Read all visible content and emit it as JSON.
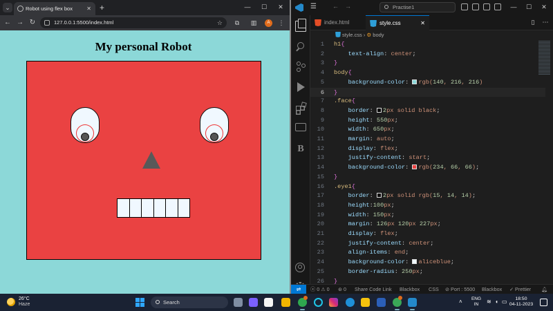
{
  "browser": {
    "tab_title": "Robot using flex box",
    "url": "127.0.0.1:5500/index.html",
    "avatar_letter": "A",
    "page_heading": "My personal Robot"
  },
  "vscode": {
    "search_text": "Practise1",
    "tabs": [
      {
        "label": "index.html",
        "active": false
      },
      {
        "label": "style.css",
        "active": true
      }
    ],
    "breadcrumb": {
      "file": "style.css",
      "symbol": "body"
    },
    "code_lines": [
      {
        "n": "1",
        "text": "h1{"
      },
      {
        "n": "2",
        "text": "    text-align: center;"
      },
      {
        "n": "3",
        "text": "}"
      },
      {
        "n": "4",
        "text": "body{"
      },
      {
        "n": "5",
        "text": "    background-color: rgb(140, 216, 216)"
      },
      {
        "n": "6",
        "text": "}"
      },
      {
        "n": "7",
        "text": ".face{"
      },
      {
        "n": "8",
        "text": "    border: 2px solid black;"
      },
      {
        "n": "9",
        "text": "    height: 550px;"
      },
      {
        "n": "10",
        "text": "    width: 650px;"
      },
      {
        "n": "11",
        "text": "    margin: auto;"
      },
      {
        "n": "12",
        "text": "    display: flex;"
      },
      {
        "n": "13",
        "text": "    justify-content: start;"
      },
      {
        "n": "14",
        "text": "    background-color: rgb(234, 66, 66);"
      },
      {
        "n": "15",
        "text": "}"
      },
      {
        "n": "16",
        "text": ".eye1{"
      },
      {
        "n": "17",
        "text": "    border: 2px solid rgb(15, 14, 14);"
      },
      {
        "n": "18",
        "text": "    height:100px;"
      },
      {
        "n": "19",
        "text": "    width: 150px;"
      },
      {
        "n": "20",
        "text": "    margin: 126px 120px 227px;"
      },
      {
        "n": "21",
        "text": "    display: flex;"
      },
      {
        "n": "22",
        "text": "    justify-content: center;"
      },
      {
        "n": "23",
        "text": "    align-items: end;"
      },
      {
        "n": "24",
        "text": "    background-color: aliceblue;"
      },
      {
        "n": "25",
        "text": "    border-radius: 250px;"
      },
      {
        "n": "26",
        "text": "}"
      }
    ],
    "active_line": "6",
    "status": {
      "errors": "0",
      "warnings": "0",
      "ports": "0",
      "share": "Share Code Link",
      "blackbox1": "Blackbox",
      "language": "CSS",
      "port": "Port : 5500",
      "blackbox2": "Blackbox",
      "prettier": "Prettier"
    }
  },
  "taskbar": {
    "temperature": "26°C",
    "weather": "Haze",
    "search_label": "Search",
    "lang_top": "ENG",
    "lang_bottom": "IN",
    "time": "18:50",
    "date": "04-11-2023"
  },
  "colors": {
    "page_bg": "#8cd8d8",
    "face": "#ea4242",
    "eye": "#f0f8ff",
    "vscode_accent": "#0078d4"
  }
}
